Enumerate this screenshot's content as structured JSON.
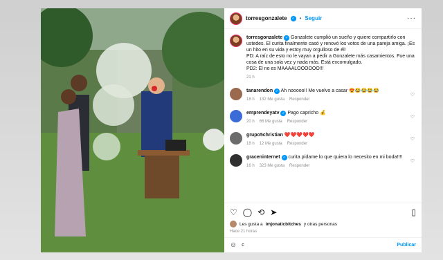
{
  "header": {
    "username": "torresgonzalete",
    "separator": "•",
    "follow_label": "Seguir",
    "more_icon": "more-horizontal-icon"
  },
  "caption": {
    "username": "torresgonzalete",
    "lines": [
      "Gonzalete cumplió un sueño y quiere compartirlo con ustedes. El curita finalmente casó y renovó los votos de una pareja amiga. ¡Es un hito en su vida y estoy muy orgulloso de él!",
      "PD: A raíz de esto no le vayan a pedir a Gonzalete más casamientos. Fue una cosa de una sola vez y nada más. Está excomulgado.",
      "PD2: El no es MAAAALOOOOOO!!!"
    ],
    "time": "21 h"
  },
  "comments": [
    {
      "username": "tanarendon",
      "text": "Ah nooooo!! Me vuelvo a casar",
      "emojis": "😍😂😂😂😂",
      "time": "18 h",
      "likes": "132 Me gusta",
      "reply": "Responder"
    },
    {
      "username": "emprendeyatv",
      "text": "Pago capricho",
      "emojis": "💰",
      "time": "20 h",
      "likes": "66 Me gusta",
      "reply": "Responder"
    },
    {
      "username": "grupo5christian",
      "text": "",
      "emojis": "❤️❤️❤️❤️❤️",
      "time": "18 h",
      "likes": "12 Me gusta",
      "reply": "Responder"
    },
    {
      "username": "graceninternet",
      "text": "curita pídame lo que quiera lo necesito en mi boda!!!!",
      "emojis": "",
      "time": "16 h",
      "likes": "323 Me gusta",
      "reply": "Responder"
    }
  ],
  "actions": {
    "likes_prefix": "Les gusta a",
    "likes_user": "imjonaticbitches",
    "likes_suffix": "y otras personas",
    "ago": "Hace 21 horas"
  },
  "composer": {
    "value": "c",
    "publish_label": "Publicar"
  },
  "colors": {
    "accent": "#0095f6",
    "text": "#111111",
    "muted": "#8e8e8e"
  }
}
